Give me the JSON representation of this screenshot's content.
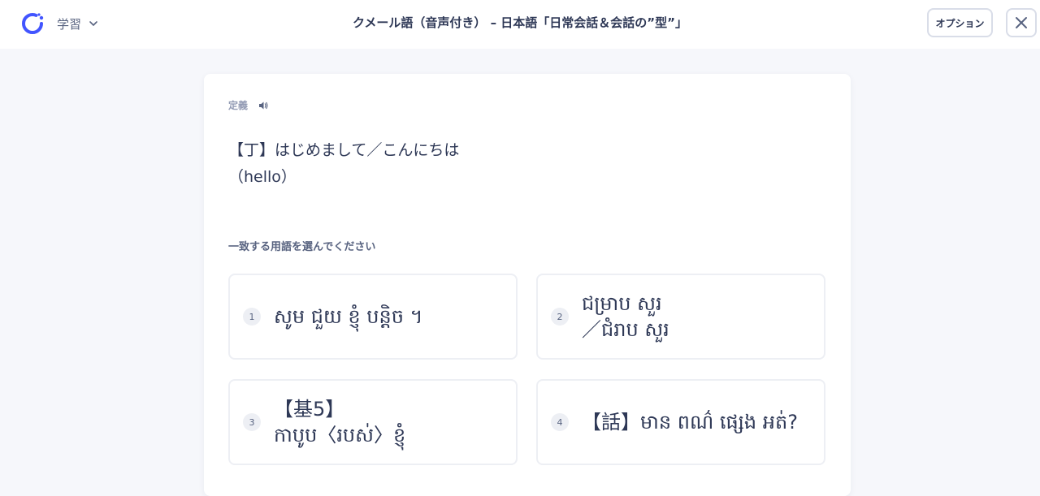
{
  "header": {
    "mode_label": "学習",
    "title": "クメール語（音声付き） – 日本語「日常会話＆会話の”型”」",
    "options_label": "オプション"
  },
  "card": {
    "definition_label": "定義",
    "term_line1": "【丁】はじめまして／こんにちは",
    "term_line2": "（hello）",
    "prompt": "一致する用語を選んでください",
    "choices": [
      {
        "num": "1",
        "line1": "សូម ជួយ ខ្ញុំ បន្តិច ។",
        "line2": ""
      },
      {
        "num": "2",
        "line1": "ជម្រាប សួរ",
        "line2": "／ជំរាប សួរ"
      },
      {
        "num": "3",
        "line1": "【基5】",
        "line2": "កាបូប〈របស់〉ខ្ញុំ"
      },
      {
        "num": "4",
        "line1": "【話】មាន ពណ៌ ផ្សេង អត់?",
        "line2": ""
      }
    ]
  },
  "colors": {
    "background": "#f6f7fb",
    "text": "#2e3856",
    "muted": "#939bb4",
    "border": "#edeff4",
    "logo_blue": "#4255ff"
  },
  "icons": {
    "logo": "quizlet-logo-icon",
    "chevron": "chevron-down-icon",
    "close": "close-icon",
    "speaker": "speaker-icon"
  }
}
